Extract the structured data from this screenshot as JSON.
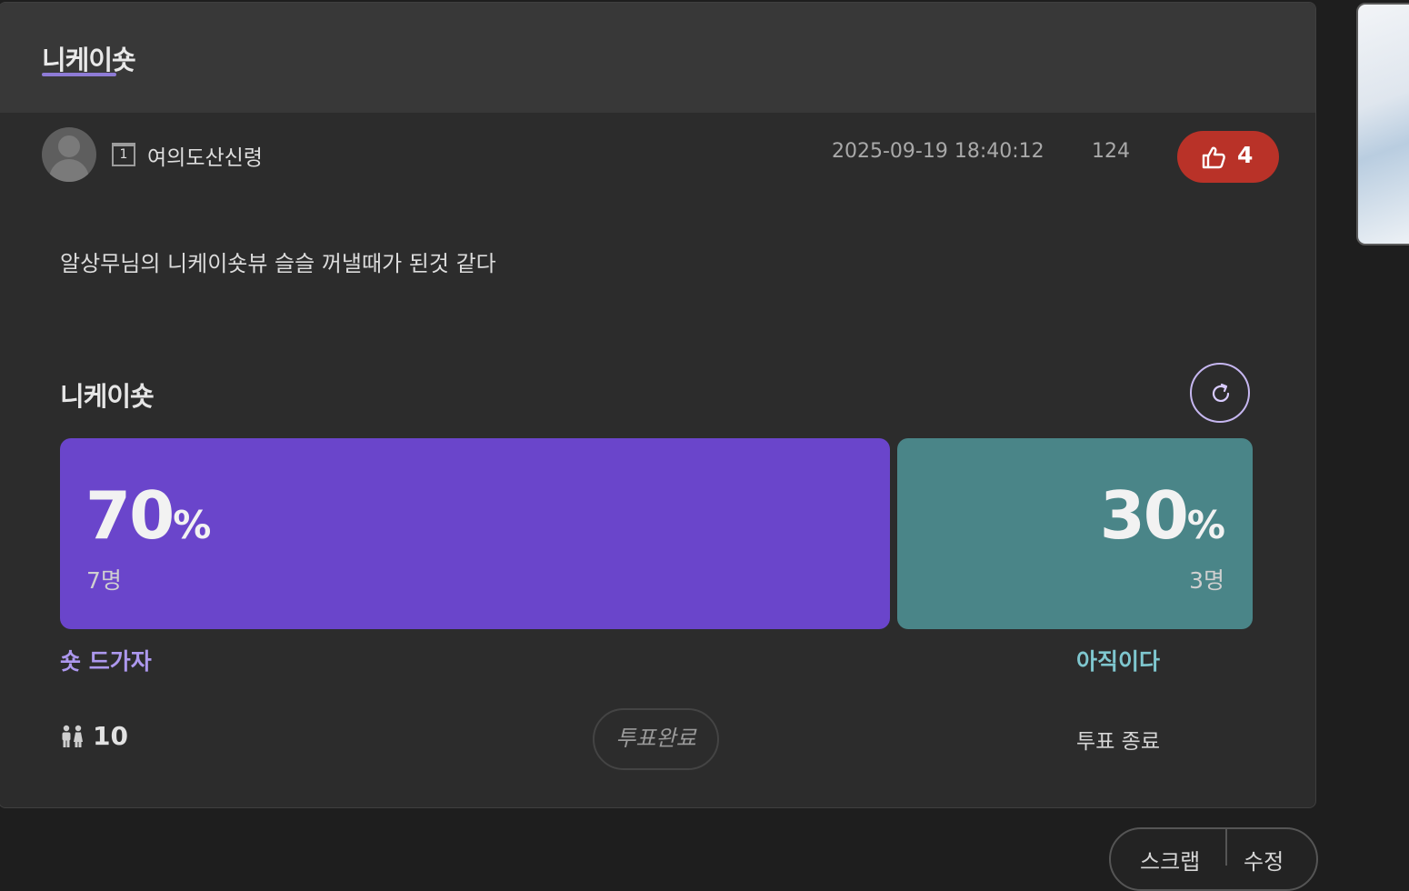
{
  "board": {
    "title": "니케이숏"
  },
  "post": {
    "author": "여의도산신령",
    "level": "1",
    "datetime": "2025-09-19 18:40:12",
    "views": "124",
    "likes": "4",
    "body": "알상무님의 니케이숏뷰 슬슬 꺼낼때가 된것 같다"
  },
  "poll": {
    "title": "니케이숏",
    "options": [
      {
        "label": "숏 드가자",
        "percent": "70",
        "percent_unit": "%",
        "count": "7명",
        "share": 0.7,
        "color": "#6a45cb"
      },
      {
        "label": "아직이다",
        "percent": "30",
        "percent_unit": "%",
        "count": "3명",
        "share": 0.3,
        "color": "#4a8588"
      }
    ],
    "total_voters": "10",
    "status": "투표완료",
    "end_label": "투표 종료"
  },
  "bottom": {
    "scrap": "스크랩",
    "report": "수정"
  },
  "colors": {
    "like": "#b93228",
    "accent": "#8e7bd6"
  }
}
